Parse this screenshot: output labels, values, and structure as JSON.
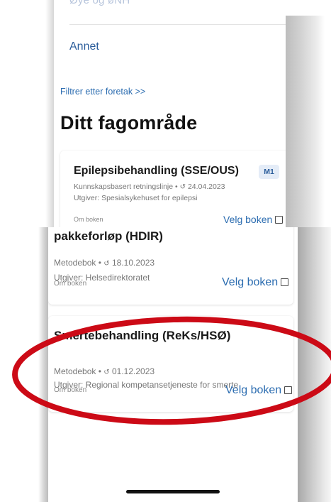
{
  "menu": {
    "faded_item": "Øye og øNH",
    "annet_label": "Annet"
  },
  "filter_link": "Filtrer etter foretak >>",
  "section_title": "Ditt fagområde",
  "books": [
    {
      "title": "Epilepsibehandling (SSE/OUS)",
      "badge": "M1",
      "type": "Kunnskapsbasert retningslinje",
      "date": "24.04.2023",
      "publisher": "Utgiver: Spesialsykehuset for epilepsi",
      "about_label": "Om boken",
      "choose_label": "Velg boken"
    },
    {
      "title": "Kreft - handlingsprogram og pakkeforløp (HDIR)",
      "type": "Metodebok",
      "date": "18.10.2023",
      "publisher": "Utgiver: Helsedirektoratet",
      "about_label": "Om boken",
      "choose_label": "Velg boken"
    },
    {
      "title": "Smertebehandling (ReKs/HSØ)",
      "type": "Metodebok",
      "date": "01.12.2023",
      "publisher": "Utgiver: Regional kompetansetjeneste for smerte",
      "about_label": "Om boken",
      "choose_label": "Velg boken"
    }
  ],
  "glyphs": {
    "separator": "•",
    "history_icon": "↺"
  },
  "colors": {
    "link_blue": "#2b6cb0",
    "title_text": "#121212",
    "meta_text": "#777777",
    "badge_bg": "#e4ecf7",
    "annotation_red": "#cc0a16"
  }
}
